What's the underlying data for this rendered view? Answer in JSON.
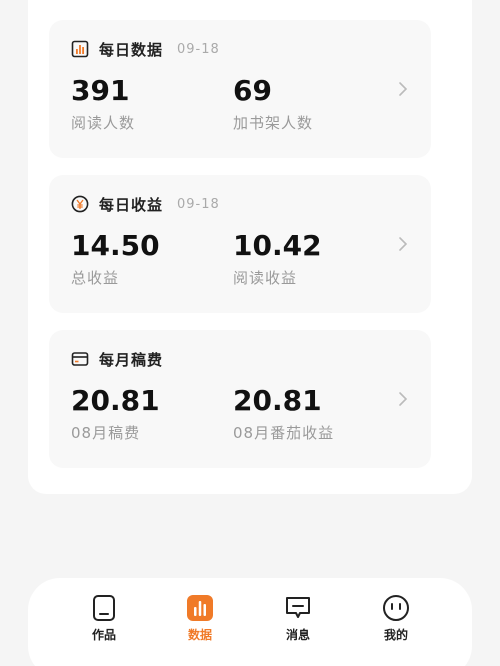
{
  "cards": [
    {
      "title": "每日数据",
      "date": "09-18",
      "icon": "bar-chart-icon",
      "metrics": [
        {
          "value": "391",
          "label": "阅读人数"
        },
        {
          "value": "69",
          "label": "加书架人数"
        }
      ]
    },
    {
      "title": "每日收益",
      "date": "09-18",
      "icon": "yen-coin-icon",
      "metrics": [
        {
          "value": "14.50",
          "label": "总收益"
        },
        {
          "value": "10.42",
          "label": "阅读收益"
        }
      ]
    },
    {
      "title": "每月稿费",
      "date": "",
      "icon": "card-icon",
      "metrics": [
        {
          "value": "20.81",
          "label": "08月稿费"
        },
        {
          "value": "20.81",
          "label": "08月番茄收益"
        }
      ]
    }
  ],
  "tabbar": {
    "items": [
      {
        "label": "作品",
        "icon": "book-icon"
      },
      {
        "label": "数据",
        "icon": "data-chart-icon",
        "active": true
      },
      {
        "label": "消息",
        "icon": "message-icon"
      },
      {
        "label": "我的",
        "icon": "face-icon"
      }
    ]
  },
  "colors": {
    "accent": "#f07a28",
    "card_bg": "#f8f8f8",
    "page_bg": "#f5f5f5"
  }
}
